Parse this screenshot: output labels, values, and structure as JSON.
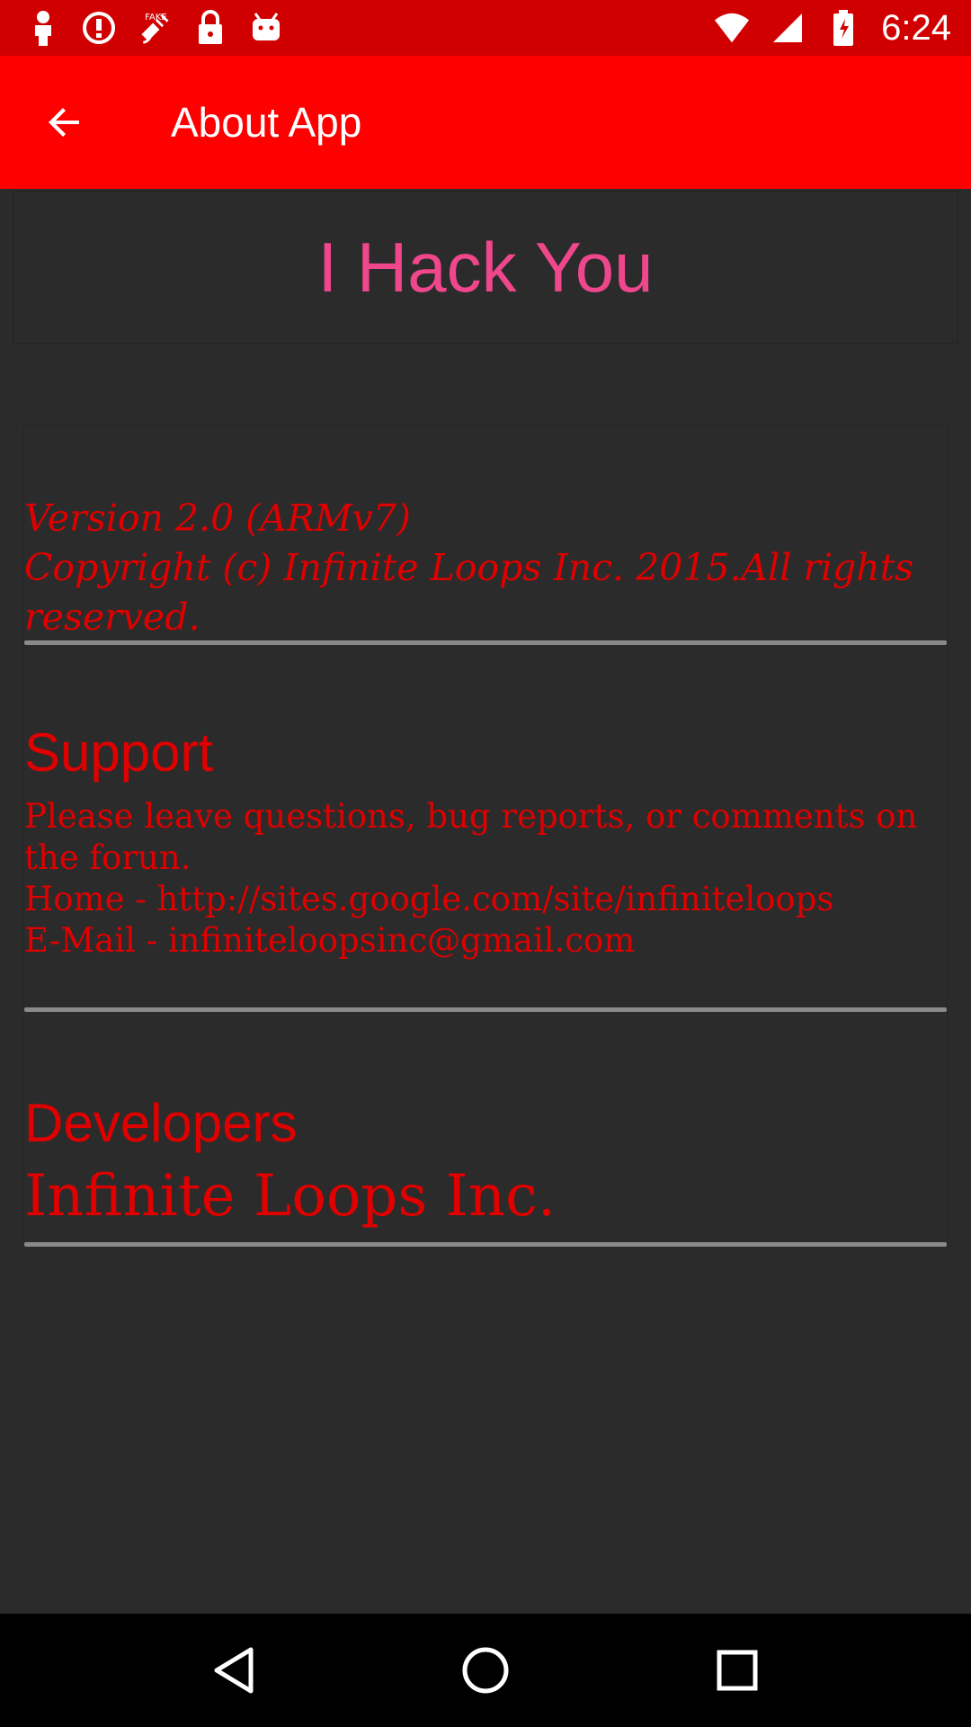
{
  "status_bar": {
    "time": "6:24",
    "icons_left": [
      "person-pin-icon",
      "alert-circle-icon",
      "fake-gps-icon",
      "lock-icon",
      "android-icon"
    ],
    "icons_right": [
      "wifi-icon",
      "signal-icon",
      "battery-icon"
    ]
  },
  "app_bar": {
    "title": "About App",
    "back_icon": "arrow-left-icon",
    "color": "#ff0000"
  },
  "app_name": "I Hack You",
  "version": {
    "line1": "Version 2.0 (ARMv7)",
    "line2": "Copyright (c) Infinite Loops Inc. 2015.All rights reserved."
  },
  "support": {
    "title": "Support",
    "line1": "Please leave questions, bug reports, or comments on the forun.",
    "line2": "Home - http://sites.google.com/site/infiniteloops",
    "line3": "E-Mail - infiniteloopsinc@gmail.com"
  },
  "developers": {
    "title": "Developers",
    "name": "Infinite Loops Inc."
  },
  "nav_bar": {
    "back_icon": "triangle-back-icon",
    "home_icon": "circle-home-icon",
    "recents_icon": "square-recents-icon"
  },
  "colors": {
    "status_bar": "#d10000",
    "accent_red": "#e00000",
    "pink": "#f0478c",
    "background": "#2b2b2b"
  }
}
